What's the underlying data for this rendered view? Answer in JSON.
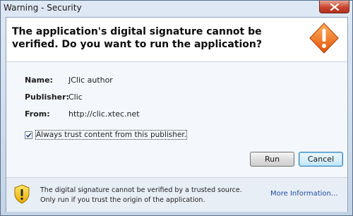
{
  "window": {
    "title": "Warning - Security"
  },
  "header": {
    "headline": "The application's digital signature cannot be verified. Do you want to run the application?",
    "icon": "warning-diamond-icon",
    "icon_color": "#ef6c1a"
  },
  "details": {
    "name_label": "Name:",
    "name_value": "JClic author",
    "publisher_label": "Publisher:",
    "publisher_value": "Clic",
    "from_label": "From:",
    "from_value": "http://clic.xtec.net"
  },
  "trust": {
    "checked": true,
    "label": "Always trust content from this publisher."
  },
  "buttons": {
    "run": "Run",
    "cancel": "Cancel"
  },
  "footer": {
    "icon": "warning-shield-icon",
    "icon_color": "#f4c20d",
    "message": "The digital signature cannot be verified by a trusted source.  Only run if you trust the origin of the application.",
    "link": "More Information..."
  }
}
